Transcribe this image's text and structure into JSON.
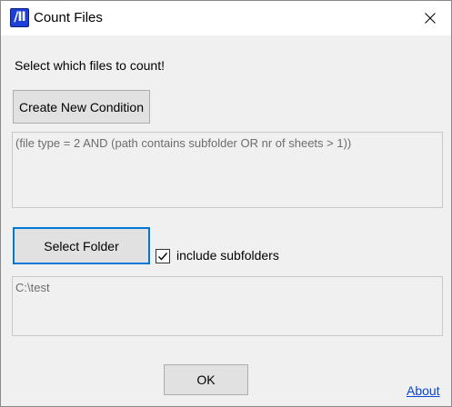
{
  "window": {
    "title": "Count Files",
    "app_icon_glyph": "/II",
    "close_icon": "close-icon"
  },
  "main": {
    "prompt": "Select which files to count!",
    "create_condition_label": "Create New Condition",
    "condition_text": "(file type = 2 AND (path contains subfolder OR nr of sheets > 1))",
    "select_folder_label": "Select Folder",
    "include_subfolders_label": "include subfolders",
    "include_subfolders_checked": true,
    "folder_path": "C:\\test",
    "ok_label": "OK",
    "about_label": "About"
  },
  "colors": {
    "accent_focus": "#0078d7",
    "link": "#0645d6",
    "app_icon": "#1c3fd6"
  }
}
